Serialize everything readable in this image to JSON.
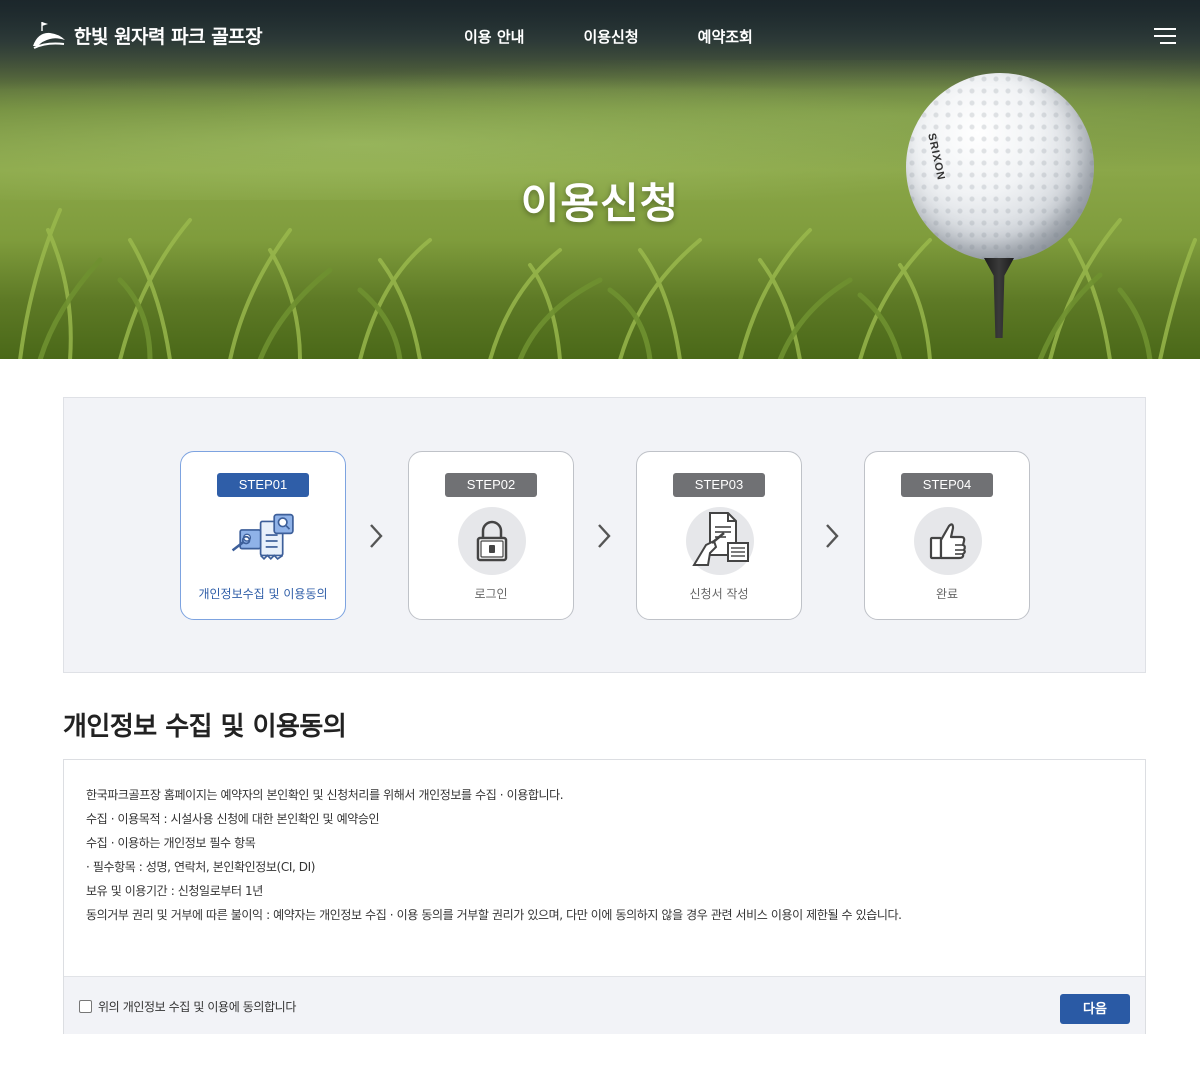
{
  "header": {
    "logo_text": "한빛 원자력 파크 골프장",
    "nav": [
      "이용 안내",
      "이용신청",
      "예약조회"
    ],
    "menu_icon": "hamburger-menu-icon"
  },
  "hero": {
    "title": "이용신청",
    "ball_brand": "SRIXON"
  },
  "steps": [
    {
      "badge": "STEP01",
      "label": "개인정보수집 및 이용동의",
      "icon": "privacy-consent-icon",
      "active": true
    },
    {
      "badge": "STEP02",
      "label": "로그인",
      "icon": "lock-icon",
      "active": false
    },
    {
      "badge": "STEP03",
      "label": "신청서 작성",
      "icon": "application-form-icon",
      "active": false
    },
    {
      "badge": "STEP04",
      "label": "완료",
      "icon": "thumbs-up-icon",
      "active": false
    }
  ],
  "consent": {
    "title": "개인정보 수집 및 이용동의",
    "lines": [
      "한국파크골프장 홈페이지는 예약자의 본인확인 및 신청처리를 위해서 개인정보를 수집 · 이용합니다.",
      "수집 · 이용목적 : 시설사용 신청에 대한 본인확인 및 예약승인",
      "수집 · 이용하는 개인정보 필수 항목",
      "· 필수항목 : 성명, 연락처, 본인확인정보(CI, DI)",
      "보유 및 이용기간 : 신청일로부터 1년",
      "동의거부 권리 및 거부에 따른 불이익 : 예약자는 개인정보 수집 · 이용 동의를 거부할 권리가 있으며, 다만 이에 동의하지 않을 경우 관련 서비스 이용이 제한될 수 있습니다."
    ],
    "agree_label": "위의 개인정보 수집 및 이용에 동의합니다",
    "agree_checked": false,
    "next_label": "다음"
  },
  "colors": {
    "accent": "#2f5ea8",
    "badge_inactive": "#707174",
    "panel_bg": "#f2f3f7"
  }
}
